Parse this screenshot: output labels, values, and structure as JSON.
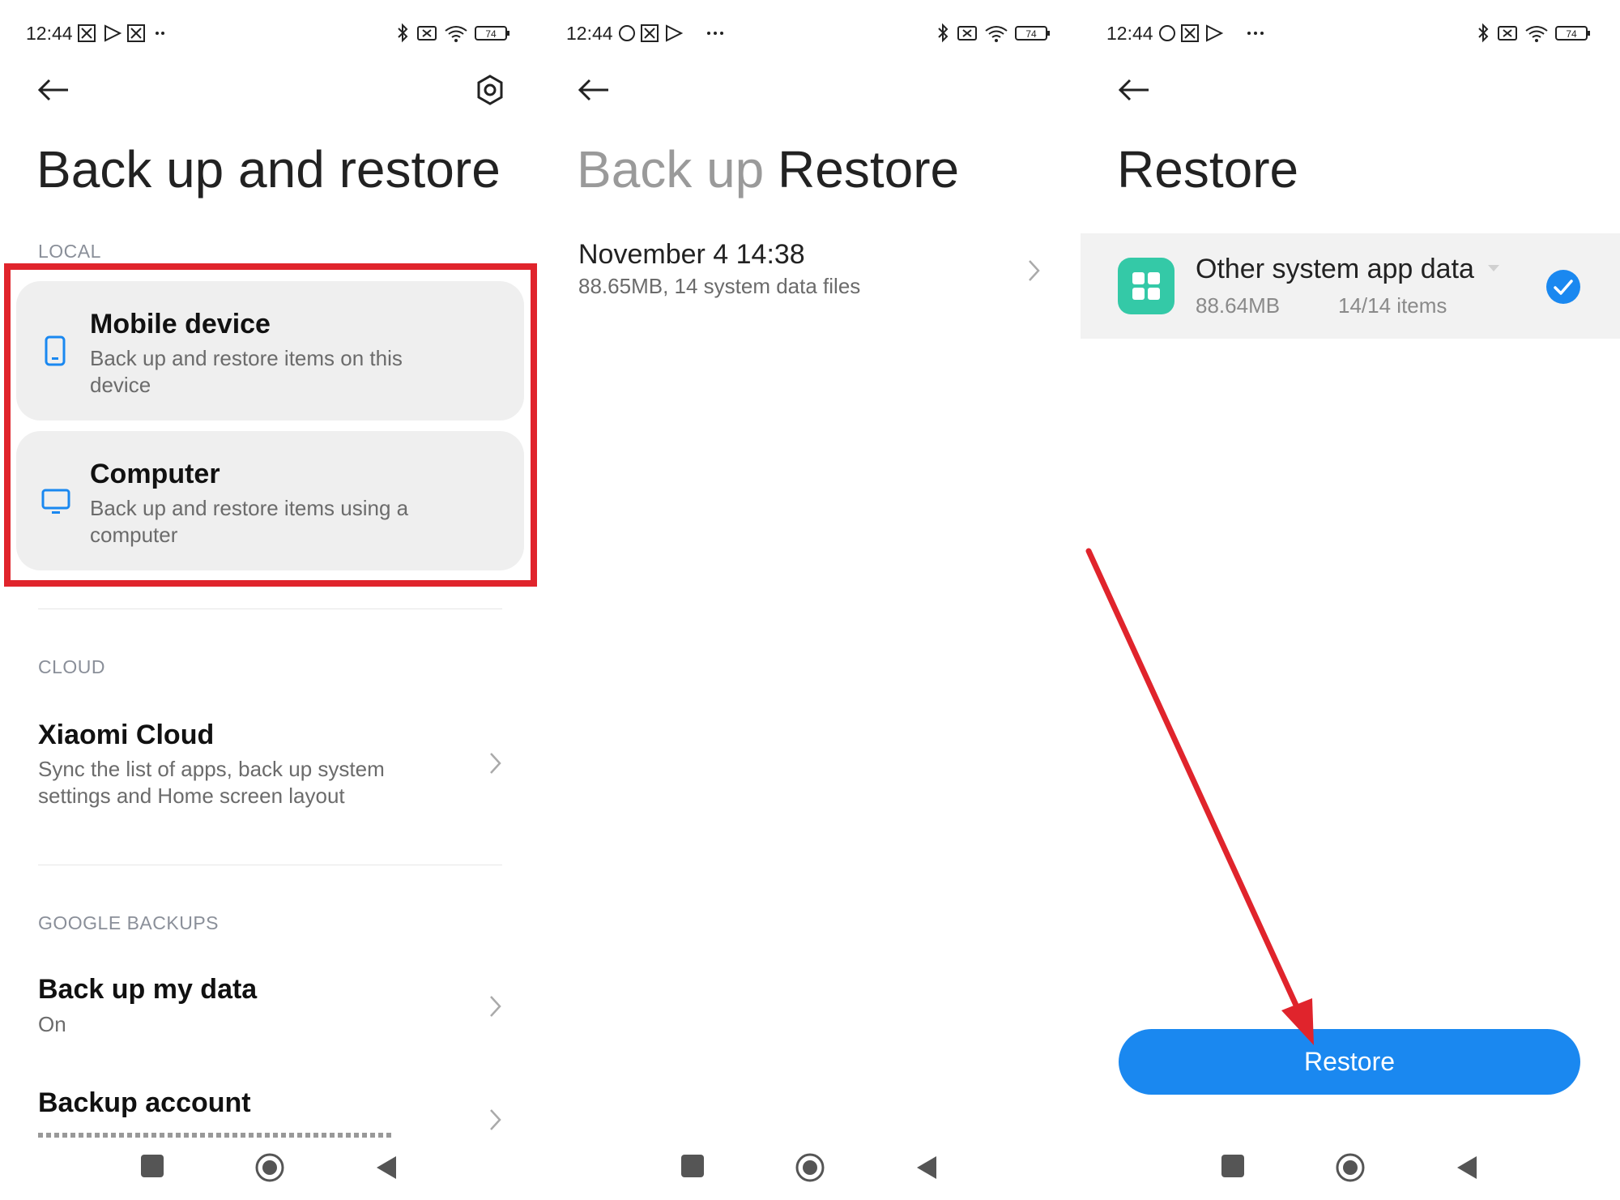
{
  "status": {
    "time": "12:44",
    "battery": "74"
  },
  "panel1": {
    "title": "Back up and restore",
    "local_label": "LOCAL",
    "mobile_title": "Mobile device",
    "mobile_sub1": "Back up and restore items on this",
    "mobile_sub2": "device",
    "computer_title": "Computer",
    "computer_sub1": "Back up and restore items using a",
    "computer_sub2": "computer",
    "cloud_label": "CLOUD",
    "cloud_title": "Xiaomi Cloud",
    "cloud_sub1": "Sync the list of apps, back up system",
    "cloud_sub2": "settings and Home screen layout",
    "google_label": "GOOGLE BACKUPS",
    "backup_title": "Back up my data",
    "backup_sub": "On",
    "account_title": "Backup account"
  },
  "panel2": {
    "tab_backup": "Back up",
    "tab_restore": "Restore",
    "entry_title": "November 4 14:38",
    "entry_sub": "88.65MB, 14 system data files"
  },
  "panel3": {
    "title": "Restore",
    "item_title": "Other system app data",
    "item_size": "88.64MB",
    "item_count": "14/14 items",
    "button": "Restore"
  },
  "colors": {
    "accent": "#1a88f0",
    "highlight": "#e0242c",
    "app_icon": "#34c9a7"
  }
}
